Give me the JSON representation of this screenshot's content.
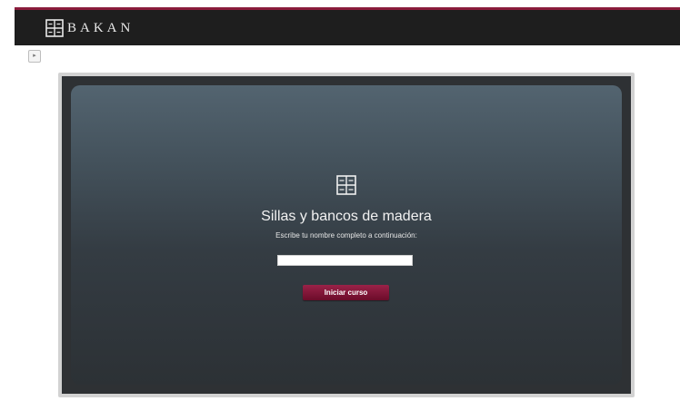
{
  "header": {
    "brand": "BAKAN",
    "logo_icon": "bakan-logo-icon",
    "accent_color": "#8a1c3c"
  },
  "toolbar": {
    "toggle_icon": "expand-toggle-icon"
  },
  "course": {
    "icon": "bakan-mark-icon",
    "title": "Sillas y bancos de madera",
    "subtitle": "Escribe tu nombre completo a continuación:",
    "name_value": "",
    "start_label": "Iniciar curso",
    "button_color": "#7d1534"
  }
}
